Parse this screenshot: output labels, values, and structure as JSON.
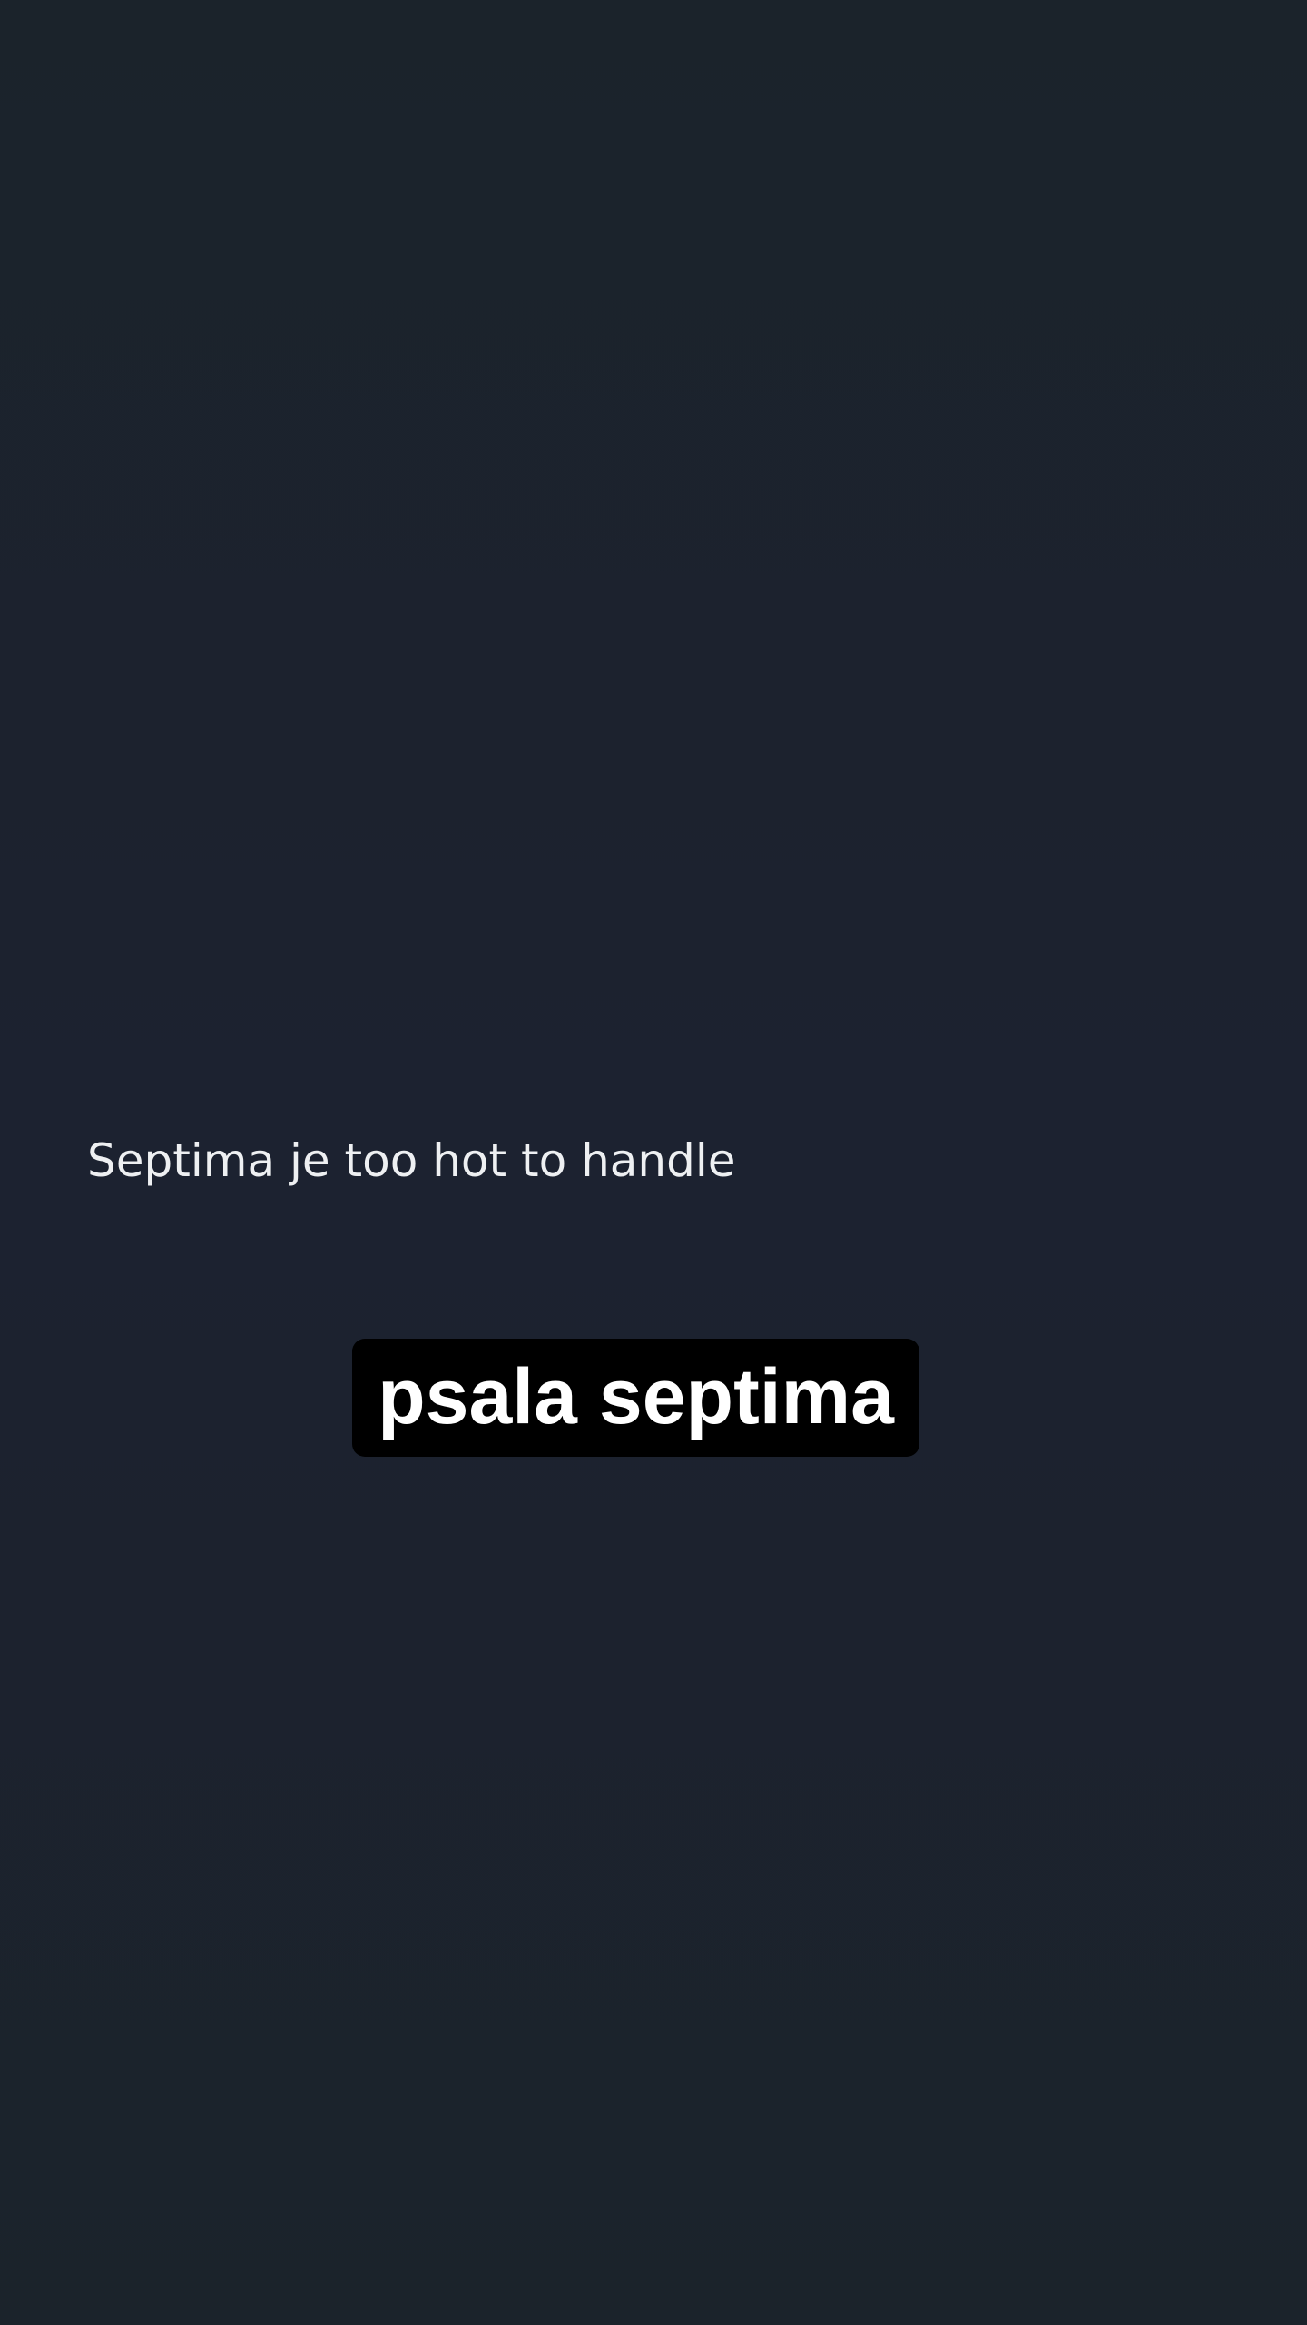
{
  "story": {
    "caption": "Septima je too hot to handle",
    "sticker_text": "psala septima"
  },
  "colors": {
    "background": "#1b232b",
    "caption_text": "#eef0f2",
    "sticker_background": "#000000",
    "sticker_text": "#ffffff"
  }
}
